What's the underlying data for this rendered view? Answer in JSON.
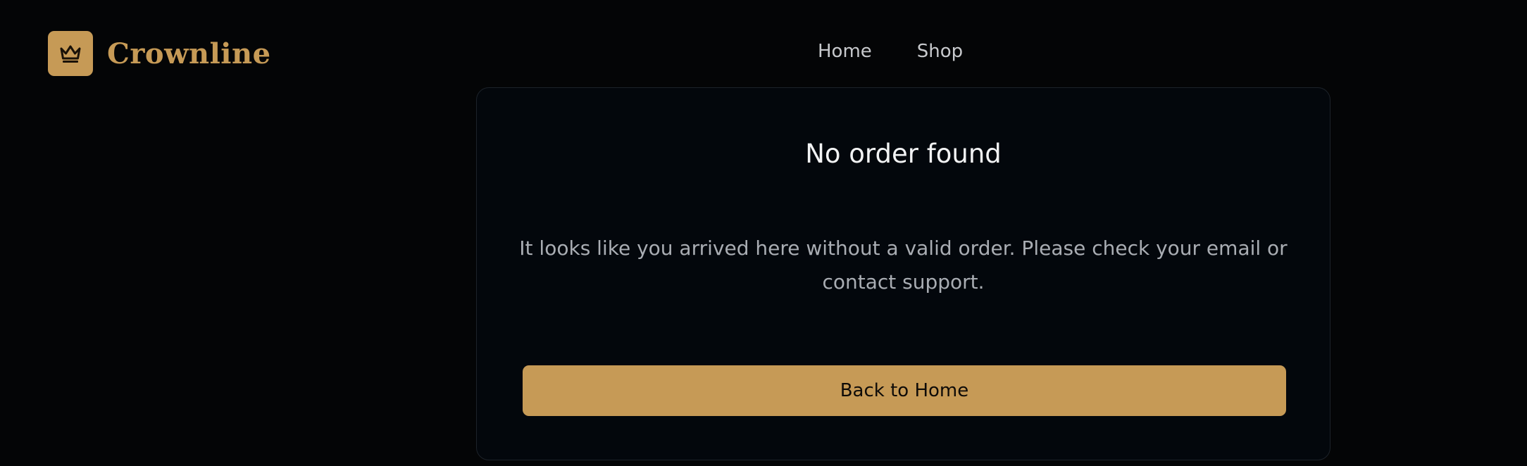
{
  "brand": {
    "name": "Crownline",
    "icon": "crown-icon",
    "accent_color": "#c69a56"
  },
  "nav": {
    "items": [
      {
        "label": "Home"
      },
      {
        "label": "Shop"
      }
    ]
  },
  "card": {
    "title": "No order found",
    "message": "It looks like you arrived here without a valid order. Please check your email or contact support.",
    "button_label": "Back to Home"
  }
}
